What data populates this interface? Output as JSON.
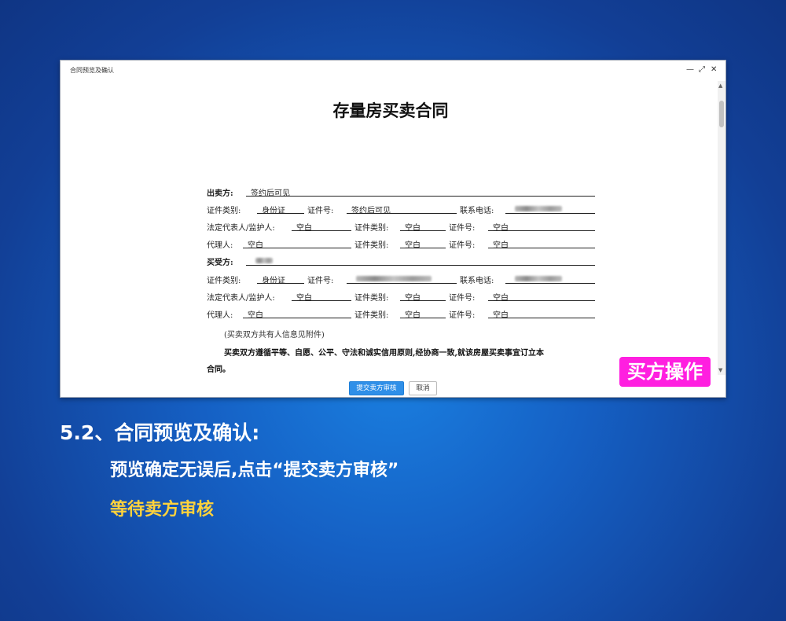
{
  "dialog": {
    "title": "合同预览及确认",
    "controls": {
      "minimize": "—",
      "maximize": "⤢",
      "close": "✕"
    }
  },
  "document": {
    "title": "存量房买卖合同",
    "seller": {
      "heading": "出卖方:",
      "name": "签约后可见",
      "id_type_label": "证件类别:",
      "id_type": "身份证",
      "id_no_label": "证件号:",
      "id_no": "签约后可见",
      "phone_label": "联系电话:",
      "legal_rep_label": "法定代表人/监护人:",
      "legal_rep": "空白",
      "lr_id_type_label": "证件类别:",
      "lr_id_type": "空白",
      "lr_id_no_label": "证件号:",
      "lr_id_no": "空白",
      "agent_label": "代理人:",
      "agent": "空白",
      "ag_id_type_label": "证件类别:",
      "ag_id_type": "空白",
      "ag_id_no_label": "证件号:",
      "ag_id_no": "空白"
    },
    "buyer": {
      "heading": "买受方:",
      "id_type_label": "证件类别:",
      "id_type": "身份证",
      "id_no_label": "证件号:",
      "phone_label": "联系电话:",
      "legal_rep_label": "法定代表人/监护人:",
      "legal_rep": "空白",
      "lr_id_type_label": "证件类别:",
      "lr_id_type": "空白",
      "lr_id_no_label": "证件号:",
      "lr_id_no": "空白",
      "agent_label": "代理人:",
      "agent": "空白",
      "ag_id_type_label": "证件类别:",
      "ag_id_type": "空白",
      "ag_id_no_label": "证件号:",
      "ag_id_no": "空白"
    },
    "co_owner_note": "(买卖双方共有人信息见附件)",
    "principle_line1": "买卖双方遵循平等、自愿、公平、守法和诚实信用原则,经协商一致,就该房屋买卖事宜订立本",
    "principle_line2": "合同。"
  },
  "buttons": {
    "submit": "提交卖方审核",
    "cancel": "取消"
  },
  "badge": "买方操作",
  "step_heading": "5.2、合同预览及确认:",
  "instruction": "预览确定无误后,点击“提交卖方审核”",
  "waiting": "等待卖方审核",
  "colors": {
    "badge": "#ff1fe0",
    "primary_button": "#2f8fe8",
    "waiting_text": "#ffd23c"
  }
}
